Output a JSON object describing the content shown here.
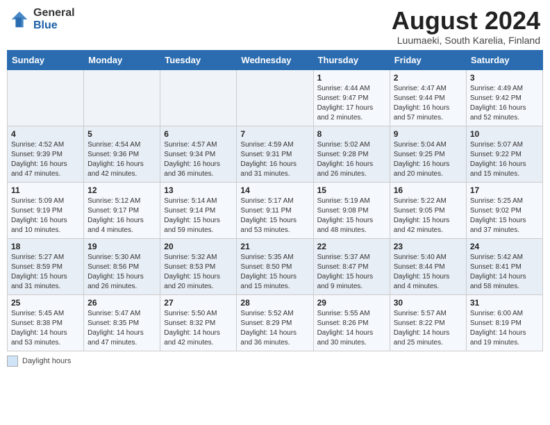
{
  "header": {
    "logo_general": "General",
    "logo_blue": "Blue",
    "month_year": "August 2024",
    "location": "Luumaeki, South Karelia, Finland"
  },
  "weekdays": [
    "Sunday",
    "Monday",
    "Tuesday",
    "Wednesday",
    "Thursday",
    "Friday",
    "Saturday"
  ],
  "weeks": [
    [
      {
        "day": "",
        "info": ""
      },
      {
        "day": "",
        "info": ""
      },
      {
        "day": "",
        "info": ""
      },
      {
        "day": "",
        "info": ""
      },
      {
        "day": "1",
        "info": "Sunrise: 4:44 AM\nSunset: 9:47 PM\nDaylight: 17 hours\nand 2 minutes."
      },
      {
        "day": "2",
        "info": "Sunrise: 4:47 AM\nSunset: 9:44 PM\nDaylight: 16 hours\nand 57 minutes."
      },
      {
        "day": "3",
        "info": "Sunrise: 4:49 AM\nSunset: 9:42 PM\nDaylight: 16 hours\nand 52 minutes."
      }
    ],
    [
      {
        "day": "4",
        "info": "Sunrise: 4:52 AM\nSunset: 9:39 PM\nDaylight: 16 hours\nand 47 minutes."
      },
      {
        "day": "5",
        "info": "Sunrise: 4:54 AM\nSunset: 9:36 PM\nDaylight: 16 hours\nand 42 minutes."
      },
      {
        "day": "6",
        "info": "Sunrise: 4:57 AM\nSunset: 9:34 PM\nDaylight: 16 hours\nand 36 minutes."
      },
      {
        "day": "7",
        "info": "Sunrise: 4:59 AM\nSunset: 9:31 PM\nDaylight: 16 hours\nand 31 minutes."
      },
      {
        "day": "8",
        "info": "Sunrise: 5:02 AM\nSunset: 9:28 PM\nDaylight: 16 hours\nand 26 minutes."
      },
      {
        "day": "9",
        "info": "Sunrise: 5:04 AM\nSunset: 9:25 PM\nDaylight: 16 hours\nand 20 minutes."
      },
      {
        "day": "10",
        "info": "Sunrise: 5:07 AM\nSunset: 9:22 PM\nDaylight: 16 hours\nand 15 minutes."
      }
    ],
    [
      {
        "day": "11",
        "info": "Sunrise: 5:09 AM\nSunset: 9:19 PM\nDaylight: 16 hours\nand 10 minutes."
      },
      {
        "day": "12",
        "info": "Sunrise: 5:12 AM\nSunset: 9:17 PM\nDaylight: 16 hours\nand 4 minutes."
      },
      {
        "day": "13",
        "info": "Sunrise: 5:14 AM\nSunset: 9:14 PM\nDaylight: 15 hours\nand 59 minutes."
      },
      {
        "day": "14",
        "info": "Sunrise: 5:17 AM\nSunset: 9:11 PM\nDaylight: 15 hours\nand 53 minutes."
      },
      {
        "day": "15",
        "info": "Sunrise: 5:19 AM\nSunset: 9:08 PM\nDaylight: 15 hours\nand 48 minutes."
      },
      {
        "day": "16",
        "info": "Sunrise: 5:22 AM\nSunset: 9:05 PM\nDaylight: 15 hours\nand 42 minutes."
      },
      {
        "day": "17",
        "info": "Sunrise: 5:25 AM\nSunset: 9:02 PM\nDaylight: 15 hours\nand 37 minutes."
      }
    ],
    [
      {
        "day": "18",
        "info": "Sunrise: 5:27 AM\nSunset: 8:59 PM\nDaylight: 15 hours\nand 31 minutes."
      },
      {
        "day": "19",
        "info": "Sunrise: 5:30 AM\nSunset: 8:56 PM\nDaylight: 15 hours\nand 26 minutes."
      },
      {
        "day": "20",
        "info": "Sunrise: 5:32 AM\nSunset: 8:53 PM\nDaylight: 15 hours\nand 20 minutes."
      },
      {
        "day": "21",
        "info": "Sunrise: 5:35 AM\nSunset: 8:50 PM\nDaylight: 15 hours\nand 15 minutes."
      },
      {
        "day": "22",
        "info": "Sunrise: 5:37 AM\nSunset: 8:47 PM\nDaylight: 15 hours\nand 9 minutes."
      },
      {
        "day": "23",
        "info": "Sunrise: 5:40 AM\nSunset: 8:44 PM\nDaylight: 15 hours\nand 4 minutes."
      },
      {
        "day": "24",
        "info": "Sunrise: 5:42 AM\nSunset: 8:41 PM\nDaylight: 14 hours\nand 58 minutes."
      }
    ],
    [
      {
        "day": "25",
        "info": "Sunrise: 5:45 AM\nSunset: 8:38 PM\nDaylight: 14 hours\nand 53 minutes."
      },
      {
        "day": "26",
        "info": "Sunrise: 5:47 AM\nSunset: 8:35 PM\nDaylight: 14 hours\nand 47 minutes."
      },
      {
        "day": "27",
        "info": "Sunrise: 5:50 AM\nSunset: 8:32 PM\nDaylight: 14 hours\nand 42 minutes."
      },
      {
        "day": "28",
        "info": "Sunrise: 5:52 AM\nSunset: 8:29 PM\nDaylight: 14 hours\nand 36 minutes."
      },
      {
        "day": "29",
        "info": "Sunrise: 5:55 AM\nSunset: 8:26 PM\nDaylight: 14 hours\nand 30 minutes."
      },
      {
        "day": "30",
        "info": "Sunrise: 5:57 AM\nSunset: 8:22 PM\nDaylight: 14 hours\nand 25 minutes."
      },
      {
        "day": "31",
        "info": "Sunrise: 6:00 AM\nSunset: 8:19 PM\nDaylight: 14 hours\nand 19 minutes."
      }
    ]
  ],
  "footer": {
    "legend_label": "Daylight hours"
  }
}
